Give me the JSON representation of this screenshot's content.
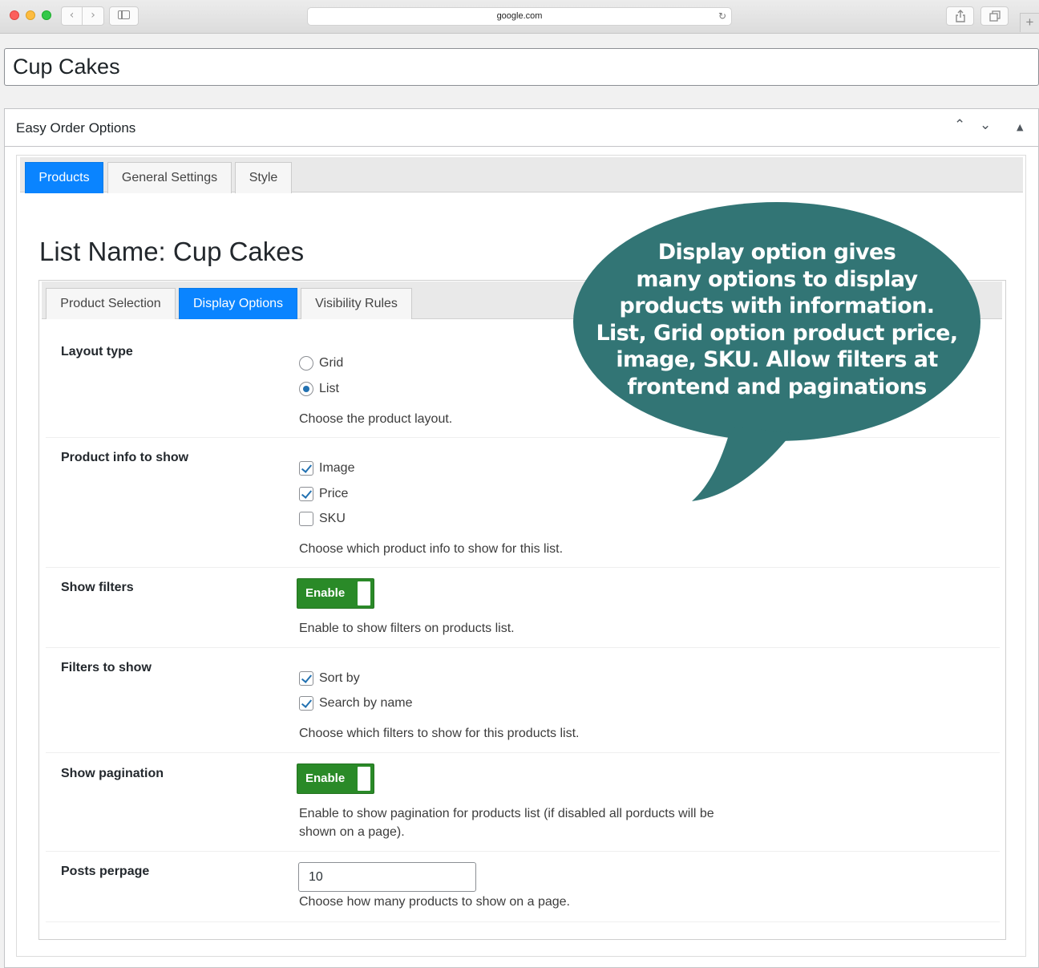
{
  "browser": {
    "url": "google.com"
  },
  "post": {
    "title": "Cup Cakes"
  },
  "metabox": {
    "title": "Easy Order Options",
    "tabs": [
      {
        "label": "Products",
        "active": true
      },
      {
        "label": "General Settings",
        "active": false
      },
      {
        "label": "Style",
        "active": false
      }
    ],
    "list_name": "List Name: Cup Cakes",
    "subtabs": [
      {
        "label": "Product Selection",
        "active": false
      },
      {
        "label": "Display Options",
        "active": true
      },
      {
        "label": "Visibility Rules",
        "active": false
      }
    ],
    "settings": {
      "layout_type": {
        "label": "Layout type",
        "options": [
          {
            "label": "Grid",
            "selected": false
          },
          {
            "label": "List",
            "selected": true
          }
        ],
        "description": "Choose the product layout."
      },
      "product_info": {
        "label": "Product info to show",
        "options": [
          {
            "label": "Image",
            "checked": true
          },
          {
            "label": "Price",
            "checked": true
          },
          {
            "label": "SKU",
            "checked": false
          }
        ],
        "description": "Choose which product info to show for this list."
      },
      "show_filters": {
        "label": "Show filters",
        "toggle_label": "Enable",
        "enabled": true,
        "description": "Enable to show filters on products list."
      },
      "filters_to_show": {
        "label": "Filters to show",
        "options": [
          {
            "label": "Sort by",
            "checked": true
          },
          {
            "label": "Search by name",
            "checked": true
          }
        ],
        "description": "Choose which filters to show for this products list."
      },
      "show_pagination": {
        "label": "Show pagination",
        "toggle_label": "Enable",
        "enabled": true,
        "description_line1": "Enable to show pagination for products list (if disabled all porducts will be",
        "description_line2": "shown on a page)."
      },
      "posts_per_page": {
        "label": "Posts perpage",
        "value": "10",
        "description": "Choose how many products to show on a page."
      }
    }
  },
  "callout": {
    "lines": [
      "Display option gives",
      "many options to display",
      "products with information.",
      "List, Grid option product price,",
      "image, SKU. Allow filters at",
      "frontend and paginations"
    ]
  },
  "colors": {
    "accent_blue": "#0a84ff",
    "toggle_green": "#2a8a28",
    "callout_teal": "#327575"
  }
}
